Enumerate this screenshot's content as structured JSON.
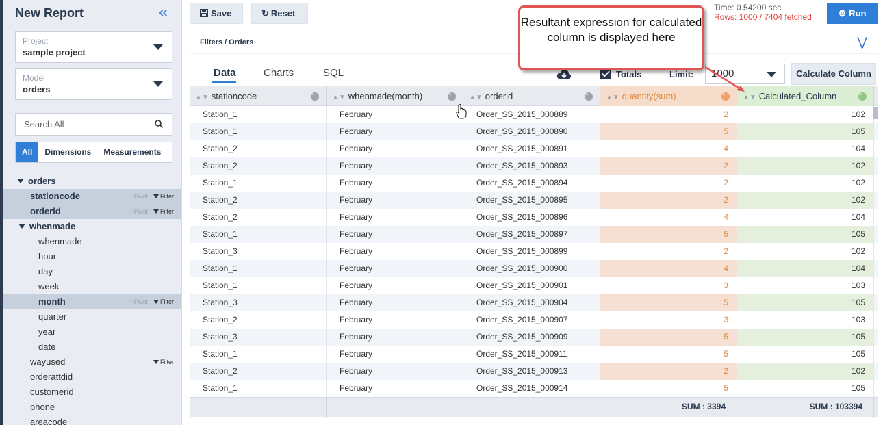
{
  "sidebar": {
    "title": "New Report",
    "project": {
      "label": "Project",
      "value": "sample project"
    },
    "model": {
      "label": "Model",
      "value": "orders"
    },
    "search_placeholder": "Search All",
    "tabs": [
      "All",
      "Dimensions",
      "Measurements"
    ],
    "tree": {
      "root": "orders",
      "stationcode": "stationcode",
      "orderid": "orderid",
      "whenmade": "whenmade",
      "children": [
        "whenmade",
        "hour",
        "day",
        "week",
        "month",
        "quarter",
        "year",
        "date"
      ],
      "others": [
        "wayused",
        "orderattdid",
        "customerid",
        "phone",
        "areacode"
      ],
      "pivot": "Pivot",
      "filter": "Filter"
    }
  },
  "toolbar": {
    "save": "Save",
    "reset": "Reset",
    "time": "Time: 0.54200 sec",
    "rows": "Rows: 1000 / 7404 fetched",
    "run": "Run"
  },
  "filters": {
    "breadcrumb": "Filters / Orders"
  },
  "view": {
    "tabs": [
      "Data",
      "Charts",
      "SQL"
    ],
    "totals_label": "Totals",
    "limit_label": "Limit:",
    "limit_value": "1000",
    "calculate_button": "Calculate Column"
  },
  "callout": {
    "text": "Resultant expression for calculated column is displayed here"
  },
  "colors": {
    "accent": "#2f7ed8",
    "quantity": "#e08a3e",
    "quantity_bg": "#f6e0d3",
    "calc_bg": "#e4f0dd",
    "annotation": "#e25555"
  },
  "table": {
    "columns": [
      "stationcode",
      "whenmade(month)",
      "orderid",
      "quantity(sum)",
      "Calculated_Column"
    ],
    "rows": [
      [
        "Station_1",
        "February",
        "Order_SS_2015_000889",
        "2",
        "102"
      ],
      [
        "Station_1",
        "February",
        "Order_SS_2015_000890",
        "5",
        "105"
      ],
      [
        "Station_2",
        "February",
        "Order_SS_2015_000891",
        "4",
        "104"
      ],
      [
        "Station_2",
        "February",
        "Order_SS_2015_000893",
        "2",
        "102"
      ],
      [
        "Station_1",
        "February",
        "Order_SS_2015_000894",
        "2",
        "102"
      ],
      [
        "Station_2",
        "February",
        "Order_SS_2015_000895",
        "2",
        "102"
      ],
      [
        "Station_2",
        "February",
        "Order_SS_2015_000896",
        "4",
        "104"
      ],
      [
        "Station_1",
        "February",
        "Order_SS_2015_000897",
        "5",
        "105"
      ],
      [
        "Station_3",
        "February",
        "Order_SS_2015_000899",
        "2",
        "102"
      ],
      [
        "Station_1",
        "February",
        "Order_SS_2015_000900",
        "4",
        "104"
      ],
      [
        "Station_1",
        "February",
        "Order_SS_2015_000901",
        "3",
        "103"
      ],
      [
        "Station_3",
        "February",
        "Order_SS_2015_000904",
        "5",
        "105"
      ],
      [
        "Station_2",
        "February",
        "Order_SS_2015_000907",
        "3",
        "103"
      ],
      [
        "Station_3",
        "February",
        "Order_SS_2015_000909",
        "5",
        "105"
      ],
      [
        "Station_1",
        "February",
        "Order_SS_2015_000911",
        "5",
        "105"
      ],
      [
        "Station_2",
        "February",
        "Order_SS_2015_000913",
        "2",
        "102"
      ],
      [
        "Station_1",
        "February",
        "Order_SS_2015_000914",
        "5",
        "105"
      ]
    ],
    "footer": {
      "quantity_sum": "SUM : 3394",
      "calc_sum": "SUM : 103394"
    }
  }
}
